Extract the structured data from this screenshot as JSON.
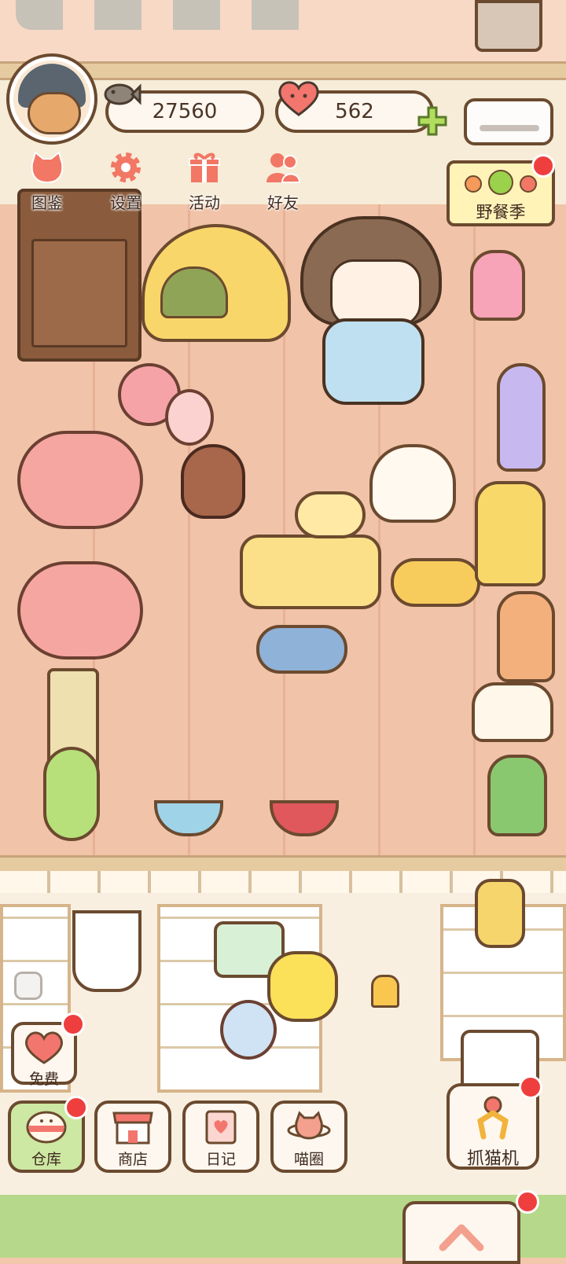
{
  "hud": {
    "coins": "27560",
    "hearts": "562"
  },
  "top_menu": [
    {
      "label": "图鉴",
      "icon": "cat-head-icon"
    },
    {
      "label": "设置",
      "icon": "gear-icon"
    },
    {
      "label": "活动",
      "icon": "gift-icon"
    },
    {
      "label": "好友",
      "icon": "friends-icon"
    }
  ],
  "event": {
    "label": "野餐季",
    "icon": "picnic-fruit-icon"
  },
  "free": {
    "label": "免费",
    "icon": "heart-icon"
  },
  "dock": [
    {
      "label": "仓库",
      "icon": "storage-icon",
      "active": true
    },
    {
      "label": "商店",
      "icon": "shop-icon",
      "active": false
    },
    {
      "label": "日记",
      "icon": "diary-icon",
      "active": false
    },
    {
      "label": "喵圈",
      "icon": "planet-cat-icon",
      "active": false
    }
  ],
  "claw": {
    "label": "抓猫机",
    "icon": "claw-icon"
  },
  "colors": {
    "outline": "#6b4a2f",
    "badge": "#ef3e3e",
    "active_tab": "#cde8a3",
    "floor": "#f1c3a8"
  }
}
